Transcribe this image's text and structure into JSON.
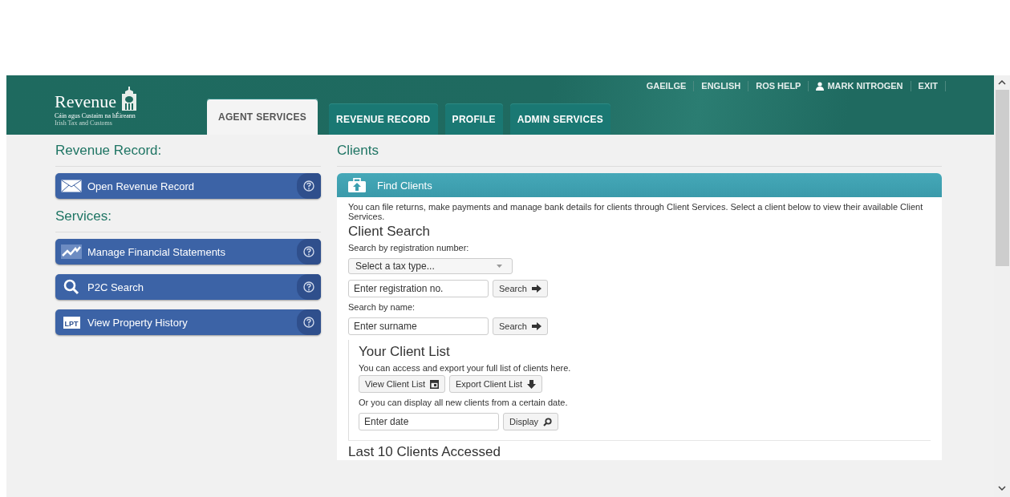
{
  "header": {
    "logo": {
      "name": "Revenue",
      "irish": "Cáin agus Custaim na hÉireann",
      "english": "Irish Tax and Customs"
    },
    "top_links": [
      {
        "label": "GAEILGE",
        "kind": "link"
      },
      {
        "label": "ENGLISH",
        "kind": "link"
      },
      {
        "label": "ROS HELP",
        "kind": "link"
      },
      {
        "label": "MARK NITROGEN",
        "kind": "user"
      },
      {
        "label": "EXIT",
        "kind": "link"
      }
    ],
    "tabs": [
      {
        "label": "AGENT SERVICES",
        "selected": true
      },
      {
        "label": "REVENUE RECORD",
        "selected": false
      },
      {
        "label": "PROFILE",
        "selected": false
      },
      {
        "label": "ADMIN SERVICES",
        "selected": false
      }
    ]
  },
  "sidebar": {
    "sections": [
      {
        "title": "Revenue Record:",
        "items": [
          {
            "label": "Open Revenue Record",
            "kind": "envelope"
          }
        ]
      },
      {
        "title": "Services:",
        "items": [
          {
            "label": "Manage Financial Statements",
            "kind": "chart"
          },
          {
            "label": "P2C Search",
            "kind": "search"
          },
          {
            "label": "View Property History",
            "kind": "lpt",
            "icon_text": "LPT"
          }
        ]
      }
    ]
  },
  "main": {
    "title": "Clients",
    "panel": {
      "title": "Find Clients",
      "intro": "You can file returns, make payments and manage bank details for clients through Client Services. Select a client below to view their available Client Services.",
      "client_search": {
        "title": "Client Search",
        "reg_label": "Search by registration number:",
        "tax_type_placeholder": "Select a tax type...",
        "reg_placeholder": "Enter registration no.",
        "reg_button": "Search",
        "name_label": "Search by name:",
        "name_placeholder": "Enter surname",
        "name_button": "Search"
      },
      "client_list": {
        "title": "Your Client List",
        "text": "You can access and export your full list of clients here.",
        "view_button": "View Client List",
        "export_button": "Export Client List",
        "date_text": "Or you can display all new clients from a certain date.",
        "date_placeholder": "Enter date",
        "display_button": "Display"
      },
      "last_title": "Last 10 Clients Accessed"
    }
  }
}
